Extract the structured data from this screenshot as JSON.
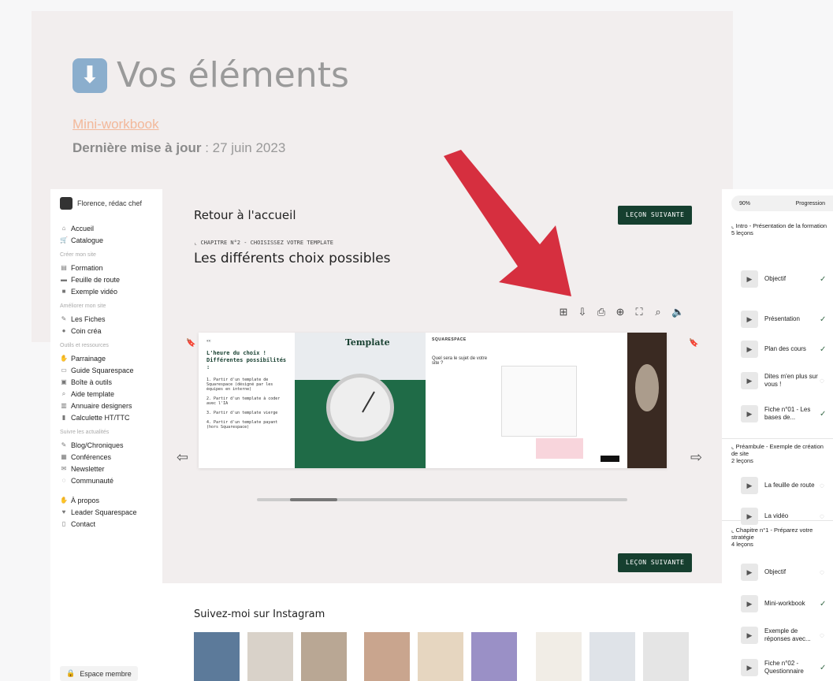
{
  "background": {
    "title": "Vos éléments",
    "link": "Mini-workbook",
    "update_label": "Dernière mise à jour",
    "update_value": " : 27 juin 2023"
  },
  "sidebar": {
    "user": "Florence, rédac chef",
    "groups": [
      {
        "section": "",
        "items": [
          {
            "icon": "home-icon",
            "glyph": "⌂",
            "label": "Accueil"
          },
          {
            "icon": "cart-icon",
            "glyph": "🛒",
            "label": "Catalogue"
          }
        ]
      },
      {
        "section": "Créer mon site",
        "items": [
          {
            "icon": "books-icon",
            "glyph": "▤",
            "label": "Formation"
          },
          {
            "icon": "road-icon",
            "glyph": "▬",
            "label": "Feuille de route"
          },
          {
            "icon": "video-icon",
            "glyph": "■",
            "label": "Exemple vidéo"
          }
        ]
      },
      {
        "section": "Améliorer mon site",
        "items": [
          {
            "icon": "paperclip-icon",
            "glyph": "✎",
            "label": "Les Fiches"
          },
          {
            "icon": "palette-icon",
            "glyph": "●",
            "label": "Coin créa"
          }
        ]
      },
      {
        "section": "Outils et ressources",
        "items": [
          {
            "icon": "handshake-icon",
            "glyph": "✋",
            "label": "Parrainage"
          },
          {
            "icon": "laptop-icon",
            "glyph": "▭",
            "label": "Guide Squarespace"
          },
          {
            "icon": "toolbox-icon",
            "glyph": "▣",
            "label": "Boîte à outils"
          },
          {
            "icon": "magnifier-icon",
            "glyph": "⌕",
            "label": "Aide template"
          },
          {
            "icon": "directory-icon",
            "glyph": "▥",
            "label": "Annuaire designers"
          },
          {
            "icon": "chart-icon",
            "glyph": "▮",
            "label": "Calculette HT/TTC"
          }
        ]
      },
      {
        "section": "Suivre les actualités",
        "items": [
          {
            "icon": "pencil-icon",
            "glyph": "✎",
            "label": "Blog/Chroniques"
          },
          {
            "icon": "calendar-icon",
            "glyph": "▦",
            "label": "Conférences"
          },
          {
            "icon": "mailbox-icon",
            "glyph": "✉",
            "label": "Newsletter"
          },
          {
            "icon": "chat-icon",
            "glyph": "◌",
            "label": "Communauté"
          }
        ]
      },
      {
        "section": "",
        "items": [
          {
            "icon": "wave-icon",
            "glyph": "✋",
            "label": "À propos"
          },
          {
            "icon": "heart-icon",
            "glyph": "♥",
            "label": "Leader Squarespace"
          },
          {
            "icon": "phone-icon",
            "glyph": "▯",
            "label": "Contact"
          }
        ]
      }
    ],
    "footer": "Espace membre"
  },
  "main": {
    "back": "Retour à l'accueil",
    "next_label": "LEÇON SUIVANTE",
    "chapter": "CHAPITRE N°2 - CHOISISSEZ VOTRE TEMPLATE",
    "title": "Les différents choix possibles",
    "page1": {
      "heading": "L'heure du choix ! Différentes possibilités :",
      "p1": "1. Partir d'un template de Squarespace (désigné par les équipes en interne)",
      "p2": "2. Partir d'un template à coder avec l'IA",
      "p3": "3. Partir d'un template vierge",
      "p4": "4. Partir d'un template payant (hors Squarespace)"
    },
    "page2": {
      "label": "Template"
    },
    "page3": {
      "logo": "SQUARESPACE",
      "question": "Quel sera le sujet de votre site ?"
    },
    "instagram_title": "Suivez-moi sur Instagram",
    "thumb_colors": [
      "#5c7a9a",
      "#d9d2c9",
      "#b9a794",
      "#c9a58e",
      "#e6d6c0",
      "#9a90c6",
      "#f1ede6",
      "#dfe3e8",
      "#e5e5e5"
    ]
  },
  "rpanel": {
    "progress_value": "90%",
    "progress_label": "Progression",
    "chapters": [
      {
        "title": "Intro - Présentation de la formation",
        "count": "5 leçons"
      },
      {
        "title": "Préambule - Exemple de création de site",
        "count": "2 leçons"
      },
      {
        "title": "Chapitre n°1 - Préparez votre stratégie",
        "count": "4 leçons"
      }
    ],
    "lessons": [
      {
        "label": "Objectif",
        "done": true
      },
      {
        "label": "Présentation",
        "done": true
      },
      {
        "label": "Plan des cours",
        "done": true
      },
      {
        "label": "Dites m'en plus sur vous !",
        "done": false
      },
      {
        "label": "Fiche n°01 - Les bases de...",
        "done": true
      },
      {
        "label": "La feuille de route",
        "done": false
      },
      {
        "label": "La vidéo",
        "done": false
      },
      {
        "label": "Objectif",
        "done": false
      },
      {
        "label": "Mini-workbook",
        "done": true
      },
      {
        "label": "Exemple de réponses avec...",
        "done": false
      },
      {
        "label": "Fiche n°02 - Questionnaire",
        "done": true
      }
    ]
  }
}
